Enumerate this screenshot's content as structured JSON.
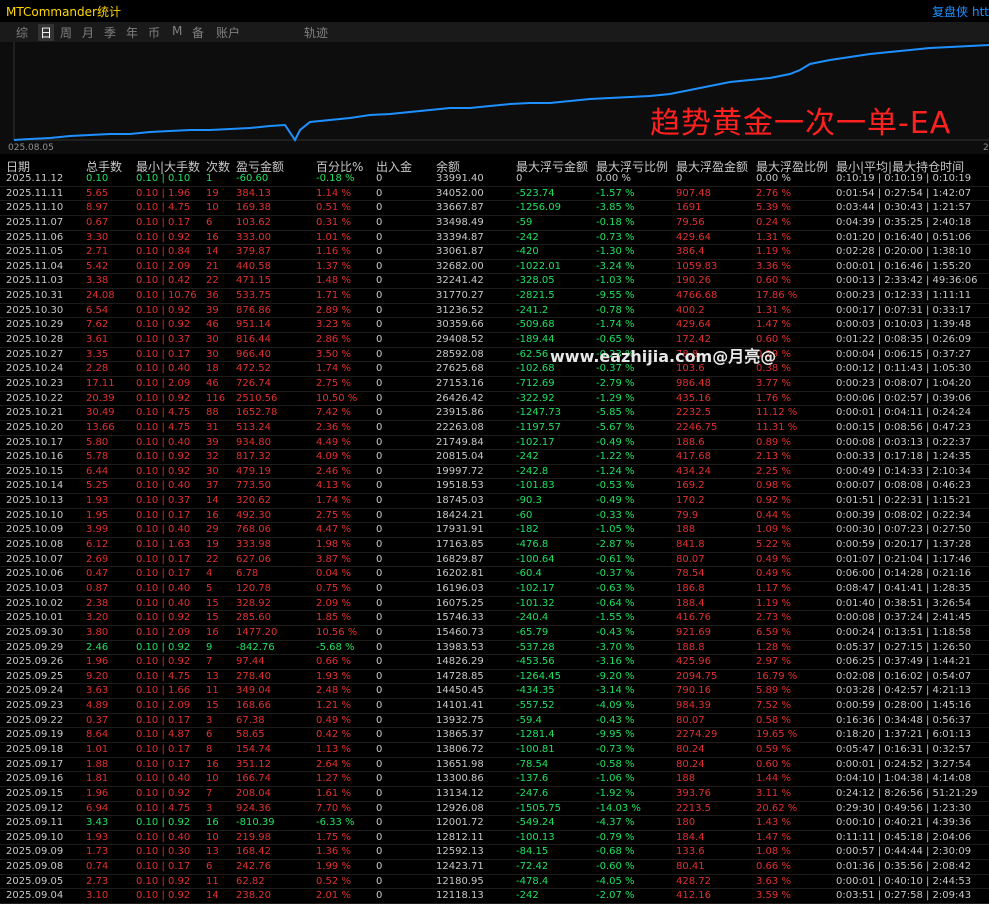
{
  "app": {
    "title": "MTCommander统计",
    "replay_link": "复盘侠 htt"
  },
  "tabs": [
    {
      "label": "综",
      "active": false
    },
    {
      "label": "日",
      "active": true
    },
    {
      "label": "周",
      "active": false
    },
    {
      "label": "月",
      "active": false
    },
    {
      "label": "季",
      "active": false
    },
    {
      "label": "年",
      "active": false
    },
    {
      "label": "币",
      "active": false
    },
    {
      "label": "M",
      "active": false
    },
    {
      "label": "备",
      "active": false
    },
    {
      "label": "账户",
      "active": false
    },
    {
      "label": "轨迹",
      "active": false
    }
  ],
  "chart": {
    "x_start": "025.08.05",
    "x_end": "2",
    "line_color": "#1e90ff"
  },
  "watermarks": {
    "ea_name": "趋势黄金一次一单-EA",
    "site": "www.eazhijia.com@月亮@"
  },
  "colors": {
    "loss": "#e03030",
    "profit": "#20e060",
    "neutral": "#c8c8c8"
  },
  "headers": [
    "日期",
    "总手数",
    "最小|大手数",
    "次数",
    "盈亏金额",
    "百分比%",
    "出入金",
    "余额",
    "最大浮亏金额",
    "最大浮亏比例",
    "最大浮盈金额",
    "最大浮盈比例",
    "最小|平均|最大持仓时间"
  ],
  "rows": [
    [
      "2025.11.12",
      "0.10",
      "0.10 | 0.10",
      "1",
      "-60.60",
      "-0.18 %",
      "0",
      "33991.40",
      "0",
      "0.00 %",
      "0",
      "0.00 %",
      "0:10:19 | 0:10:19 | 0:10:19"
    ],
    [
      "2025.11.11",
      "5.65",
      "0.10 | 1.96",
      "19",
      "384.13",
      "1.14 %",
      "0",
      "34052.00",
      "-523.74",
      "-1.57 %",
      "907.48",
      "2.76 %",
      "0:01:54 | 0:27:54 | 1:42:07"
    ],
    [
      "2025.11.10",
      "8.97",
      "0.10 | 4.75",
      "10",
      "169.38",
      "0.51 %",
      "0",
      "33667.87",
      "-1256.09",
      "-3.85 %",
      "1691",
      "5.39 %",
      "0:03:44 | 0:30:43 | 1:21:57"
    ],
    [
      "2025.11.07",
      "0.67",
      "0.10 | 0.17",
      "6",
      "103.62",
      "0.31 %",
      "0",
      "33498.49",
      "-59",
      "-0.18 %",
      "79.56",
      "0.24 %",
      "0:04:39 | 0:35:25 | 2:40:18"
    ],
    [
      "2025.11.06",
      "3.30",
      "0.10 | 0.92",
      "16",
      "333.00",
      "1.01 %",
      "0",
      "33394.87",
      "-242",
      "-0.73 %",
      "429.64",
      "1.31 %",
      "0:01:20 | 0:16:40 | 0:51:06"
    ],
    [
      "2025.11.05",
      "2.71",
      "0.10 | 0.84",
      "14",
      "379.87",
      "1.16 %",
      "0",
      "33061.87",
      "-420",
      "-1.30 %",
      "386.4",
      "1.19 %",
      "0:02:28 | 0:20:00 | 1:38:10"
    ],
    [
      "2025.11.04",
      "5.42",
      "0.10 | 2.09",
      "21",
      "440.58",
      "1.37 %",
      "0",
      "32682.00",
      "-1022.01",
      "-3.24 %",
      "1059.83",
      "3.36 %",
      "0:00:01 | 0:16:46 | 1:55:20"
    ],
    [
      "2025.11.03",
      "3.38",
      "0.10 | 0.42",
      "22",
      "471.15",
      "1.48 %",
      "0",
      "32241.42",
      "-328.05",
      "-1.03 %",
      "190.26",
      "0.60 %",
      "0:00:13 | 2:33:42 | 49:36:06"
    ],
    [
      "2025.10.31",
      "24.08",
      "0.10 | 10.76",
      "36",
      "533.75",
      "1.71 %",
      "0",
      "31770.27",
      "-2821.5",
      "-9.55 %",
      "4766.68",
      "17.86 %",
      "0:00:23 | 0:12:33 | 1:11:11"
    ],
    [
      "2025.10.30",
      "6.54",
      "0.10 | 0.92",
      "39",
      "876.86",
      "2.89 %",
      "0",
      "31236.52",
      "-241.2",
      "-0.78 %",
      "400.2",
      "1.31 %",
      "0:00:17 | 0:07:31 | 0:33:17"
    ],
    [
      "2025.10.29",
      "7.62",
      "0.10 | 0.92",
      "46",
      "951.14",
      "3.23 %",
      "0",
      "30359.66",
      "-509.68",
      "-1.74 %",
      "429.64",
      "1.47 %",
      "0:00:03 | 0:10:03 | 1:39:48"
    ],
    [
      "2025.10.28",
      "3.61",
      "0.10 | 0.37",
      "30",
      "816.44",
      "2.86 %",
      "0",
      "29408.52",
      "-189.44",
      "-0.65 %",
      "172.42",
      "0.60 %",
      "0:01:22 | 0:08:35 | 0:26:09"
    ],
    [
      "2025.10.27",
      "3.35",
      "0.10 | 0.17",
      "30",
      "966.40",
      "3.50 %",
      "0",
      "28592.08",
      "-62.56",
      "-0.23 %",
      "78.8",
      "0.29 %",
      "0:00:04 | 0:06:15 | 0:37:27"
    ],
    [
      "2025.10.24",
      "2.28",
      "0.10 | 0.40",
      "18",
      "472.52",
      "1.74 %",
      "0",
      "27625.68",
      "-102.68",
      "-0.37 %",
      "103.6",
      "0.38 %",
      "0:00:12 | 0:11:43 | 1:05:30"
    ],
    [
      "2025.10.23",
      "17.11",
      "0.10 | 2.09",
      "46",
      "726.74",
      "2.75 %",
      "0",
      "27153.16",
      "-712.69",
      "-2.79 %",
      "986.48",
      "3.77 %",
      "0:00:23 | 0:08:07 | 1:04:20"
    ],
    [
      "2025.10.22",
      "20.39",
      "0.10 | 0.92",
      "116",
      "2510.56",
      "10.50 %",
      "0",
      "26426.42",
      "-322.92",
      "-1.29 %",
      "435.16",
      "1.76 %",
      "0:00:06 | 0:02:57 | 0:39:06"
    ],
    [
      "2025.10.21",
      "30.49",
      "0.10 | 4.75",
      "88",
      "1652.78",
      "7.42 %",
      "0",
      "23915.86",
      "-1247.73",
      "-5.85 %",
      "2232.5",
      "11.12 %",
      "0:00:01 | 0:04:11 | 0:24:24"
    ],
    [
      "2025.10.20",
      "13.66",
      "0.10 | 4.75",
      "31",
      "513.24",
      "2.36 %",
      "0",
      "22263.08",
      "-1197.57",
      "-5.67 %",
      "2246.75",
      "11.31 %",
      "0:00:15 | 0:08:56 | 0:47:23"
    ],
    [
      "2025.10.17",
      "5.80",
      "0.10 | 0.40",
      "39",
      "934.80",
      "4.49 %",
      "0",
      "21749.84",
      "-102.17",
      "-0.49 %",
      "188.6",
      "0.89 %",
      "0:00:08 | 0:03:13 | 0:22:37"
    ],
    [
      "2025.10.16",
      "5.78",
      "0.10 | 0.92",
      "32",
      "817.32",
      "4.09 %",
      "0",
      "20815.04",
      "-242",
      "-1.22 %",
      "417.68",
      "2.13 %",
      "0:00:33 | 0:17:18 | 1:24:35"
    ],
    [
      "2025.10.15",
      "6.44",
      "0.10 | 0.92",
      "30",
      "479.19",
      "2.46 %",
      "0",
      "19997.72",
      "-242.8",
      "-1.24 %",
      "434.24",
      "2.25 %",
      "0:00:49 | 0:14:33 | 2:10:34"
    ],
    [
      "2025.10.14",
      "5.25",
      "0.10 | 0.40",
      "37",
      "773.50",
      "4.13 %",
      "0",
      "19518.53",
      "-101.83",
      "-0.53 %",
      "169.2",
      "0.98 %",
      "0:00:07 | 0:08:08 | 0:46:23"
    ],
    [
      "2025.10.13",
      "1.93",
      "0.10 | 0.37",
      "14",
      "320.62",
      "1.74 %",
      "0",
      "18745.03",
      "-90.3",
      "-0.49 %",
      "170.2",
      "0.92 %",
      "0:01:51 | 0:22:31 | 1:15:21"
    ],
    [
      "2025.10.10",
      "1.95",
      "0.10 | 0.17",
      "16",
      "492.30",
      "2.75 %",
      "0",
      "18424.21",
      "-60",
      "-0.33 %",
      "79.9",
      "0.44 %",
      "0:00:39 | 0:08:02 | 0:22:34"
    ],
    [
      "2025.10.09",
      "3.99",
      "0.10 | 0.40",
      "29",
      "768.06",
      "4.47 %",
      "0",
      "17931.91",
      "-182",
      "-1.05 %",
      "188",
      "1.09 %",
      "0:00:30 | 0:07:23 | 0:27:50"
    ],
    [
      "2025.10.08",
      "6.12",
      "0.10 | 1.63",
      "19",
      "333.98",
      "1.98 %",
      "0",
      "17163.85",
      "-476.8",
      "-2.87 %",
      "841.8",
      "5.22 %",
      "0:00:59 | 0:20:17 | 1:37:28"
    ],
    [
      "2025.10.07",
      "2.69",
      "0.10 | 0.17",
      "22",
      "627.06",
      "3.87 %",
      "0",
      "16829.87",
      "-100.64",
      "-0.61 %",
      "80.07",
      "0.49 %",
      "0:01:07 | 0:21:04 | 1:17:46"
    ],
    [
      "2025.10.06",
      "0.47",
      "0.10 | 0.17",
      "4",
      "6.78",
      "0.04 %",
      "0",
      "16202.81",
      "-60.4",
      "-0.37 %",
      "78.54",
      "0.49 %",
      "0:06:00 | 0:14:28 | 0:21:16"
    ],
    [
      "2025.10.03",
      "0.87",
      "0.10 | 0.40",
      "5",
      "120.78",
      "0.75 %",
      "0",
      "16196.03",
      "-102.17",
      "-0.63 %",
      "186.8",
      "1.17 %",
      "0:08:47 | 0:41:41 | 1:28:35"
    ],
    [
      "2025.10.02",
      "2.38",
      "0.10 | 0.40",
      "15",
      "328.92",
      "2.09 %",
      "0",
      "16075.25",
      "-101.32",
      "-0.64 %",
      "188.4",
      "1.19 %",
      "0:01:40 | 0:38:51 | 3:26:54"
    ],
    [
      "2025.10.01",
      "3.20",
      "0.10 | 0.92",
      "15",
      "285.60",
      "1.85 %",
      "0",
      "15746.33",
      "-240.4",
      "-1.55 %",
      "416.76",
      "2.73 %",
      "0:00:08 | 0:37:24 | 2:41:45"
    ],
    [
      "2025.09.30",
      "3.80",
      "0.10 | 2.09",
      "16",
      "1477.20",
      "10.56 %",
      "0",
      "15460.73",
      "-65.79",
      "-0.43 %",
      "921.69",
      "6.59 %",
      "0:00:24 | 0:13:51 | 1:18:58"
    ],
    [
      "2025.09.29",
      "2.46",
      "0.10 | 0.92",
      "9",
      "-842.76",
      "-5.68 %",
      "0",
      "13983.53",
      "-537.28",
      "-3.70 %",
      "188.8",
      "1.28 %",
      "0:05:37 | 0:27:15 | 1:26:50"
    ],
    [
      "2025.09.26",
      "1.96",
      "0.10 | 0.92",
      "7",
      "97.44",
      "0.66 %",
      "0",
      "14826.29",
      "-453.56",
      "-3.16 %",
      "425.96",
      "2.97 %",
      "0:06:25 | 0:37:49 | 1:44:21"
    ],
    [
      "2025.09.25",
      "9.20",
      "0.10 | 4.75",
      "13",
      "278.40",
      "1.93 %",
      "0",
      "14728.85",
      "-1264.45",
      "-9.20 %",
      "2094.75",
      "16.79 %",
      "0:02:08 | 0:16:02 | 0:54:07"
    ],
    [
      "2025.09.24",
      "3.63",
      "0.10 | 1.66",
      "11",
      "349.04",
      "2.48 %",
      "0",
      "14450.45",
      "-434.35",
      "-3.14 %",
      "790.16",
      "5.89 %",
      "0:03:28 | 0:42:57 | 4:21:13"
    ],
    [
      "2025.09.23",
      "4.89",
      "0.10 | 2.09",
      "15",
      "168.66",
      "1.21 %",
      "0",
      "14101.41",
      "-557.52",
      "-4.09 %",
      "984.39",
      "7.52 %",
      "0:00:59 | 0:28:00 | 1:45:16"
    ],
    [
      "2025.09.22",
      "0.37",
      "0.10 | 0.17",
      "3",
      "67.38",
      "0.49 %",
      "0",
      "13932.75",
      "-59.4",
      "-0.43 %",
      "80.07",
      "0.58 %",
      "0:16:36 | 0:34:48 | 0:56:37"
    ],
    [
      "2025.09.19",
      "8.64",
      "0.10 | 4.87",
      "6",
      "58.65",
      "0.42 %",
      "0",
      "13865.37",
      "-1281.4",
      "-9.95 %",
      "2274.29",
      "19.65 %",
      "0:18:20 | 1:37:21 | 6:01:13"
    ],
    [
      "2025.09.18",
      "1.01",
      "0.10 | 0.17",
      "8",
      "154.74",
      "1.13 %",
      "0",
      "13806.72",
      "-100.81",
      "-0.73 %",
      "80.24",
      "0.59 %",
      "0:05:47 | 0:16:31 | 0:32:57"
    ],
    [
      "2025.09.17",
      "1.88",
      "0.10 | 0.17",
      "16",
      "351.12",
      "2.64 %",
      "0",
      "13651.98",
      "-78.54",
      "-0.58 %",
      "80.24",
      "0.60 %",
      "0:00:01 | 0:24:52 | 3:27:54"
    ],
    [
      "2025.09.16",
      "1.81",
      "0.10 | 0.40",
      "10",
      "166.74",
      "1.27 %",
      "0",
      "13300.86",
      "-137.6",
      "-1.06 %",
      "188",
      "1.44 %",
      "0:04:10 | 1:04:38 | 4:14:08"
    ],
    [
      "2025.09.15",
      "1.96",
      "0.10 | 0.92",
      "7",
      "208.04",
      "1.61 %",
      "0",
      "13134.12",
      "-247.6",
      "-1.92 %",
      "393.76",
      "3.11 %",
      "0:24:12 | 8:26:56 | 51:21:29"
    ],
    [
      "2025.09.12",
      "6.94",
      "0.10 | 4.75",
      "3",
      "924.36",
      "7.70 %",
      "0",
      "12926.08",
      "-1505.75",
      "-14.03 %",
      "2213.5",
      "20.62 %",
      "0:29:30 | 0:49:56 | 1:23:30"
    ],
    [
      "2025.09.11",
      "3.43",
      "0.10 | 0.92",
      "16",
      "-810.39",
      "-6.33 %",
      "0",
      "12001.72",
      "-549.24",
      "-4.37 %",
      "180",
      "1.43 %",
      "0:00:10 | 0:40:21 | 4:39:36"
    ],
    [
      "2025.09.10",
      "1.93",
      "0.10 | 0.40",
      "10",
      "219.98",
      "1.75 %",
      "0",
      "12812.11",
      "-100.13",
      "-0.79 %",
      "184.4",
      "1.47 %",
      "0:11:11 | 0:45:18 | 2:04:06"
    ],
    [
      "2025.09.09",
      "1.73",
      "0.10 | 0.30",
      "13",
      "168.42",
      "1.36 %",
      "0",
      "12592.13",
      "-84.15",
      "-0.68 %",
      "133.6",
      "1.08 %",
      "0:00:57 | 0:44:44 | 2:30:09"
    ],
    [
      "2025.09.08",
      "0.74",
      "0.10 | 0.17",
      "6",
      "242.76",
      "1.99 %",
      "0",
      "12423.71",
      "-72.42",
      "-0.60 %",
      "80.41",
      "0.66 %",
      "0:01:36 | 0:35:56 | 2:08:42"
    ],
    [
      "2025.09.05",
      "2.73",
      "0.10 | 0.92",
      "11",
      "62.82",
      "0.52 %",
      "0",
      "12180.95",
      "-478.4",
      "-4.05 %",
      "428.72",
      "3.63 %",
      "0:00:01 | 0:40:10 | 2:44:53"
    ],
    [
      "2025.09.04",
      "3.10",
      "0.10 | 0.92",
      "14",
      "238.20",
      "2.01 %",
      "0",
      "12118.13",
      "-242",
      "-2.07 %",
      "412.16",
      "3.59 %",
      "0:03:51 | 0:27:58 | 2:09:43"
    ]
  ]
}
